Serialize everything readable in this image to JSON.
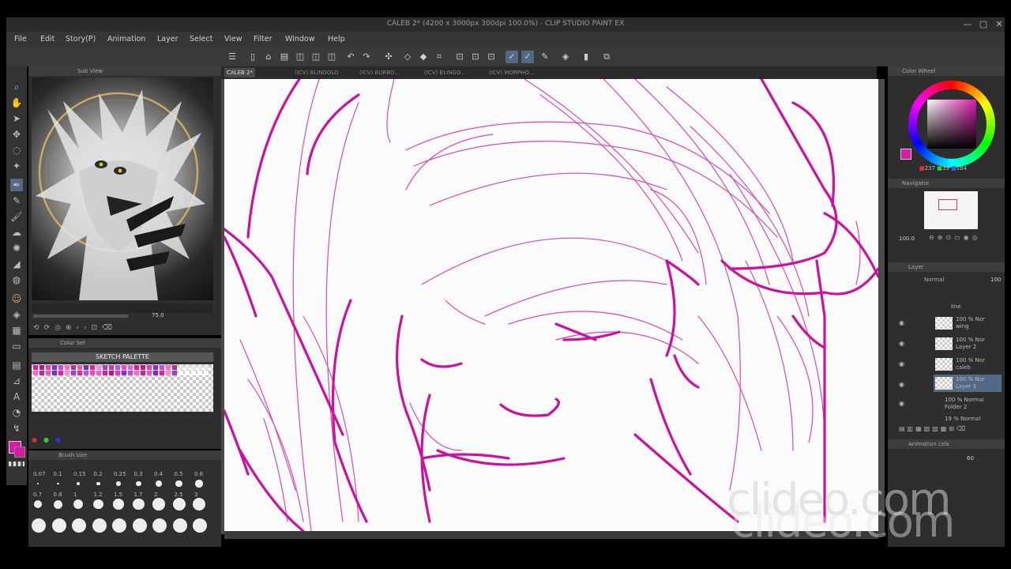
{
  "window": {
    "title": "CALEB 2* (4200 x 3000px 300dpi 100.0%) - CLIP STUDIO PAINT EX"
  },
  "menu": [
    "File",
    "Edit",
    "Story(P)",
    "Animation",
    "Layer",
    "Select",
    "View",
    "Filter",
    "Window",
    "Help"
  ],
  "canvas_tabs": [
    "CALEB 2*",
    "(ICV) BLINGOLO",
    "(ICV) BURBO...",
    "(ICV) BLINGO...",
    "(ICV) MORPHO..."
  ],
  "subview": {
    "title": "Sub View",
    "zoom": "75.0"
  },
  "color_set": {
    "title": "Color Set",
    "palette_name": "SKETCH PALETTE"
  },
  "brush_size": {
    "title": "Brush size",
    "sizes_row1": [
      "0.07",
      "0.1",
      "0.15",
      "0.2",
      "0.25",
      "0.3",
      "0.4",
      "0.5",
      "0.6"
    ],
    "sizes_row2": [
      "0.7",
      "0.8",
      "1",
      "1.2",
      "1.5",
      "1.7",
      "2",
      "2.5",
      "3"
    ]
  },
  "color_wheel": {
    "title": "Color Wheel",
    "r": "237",
    "g": "39",
    "b": "184"
  },
  "navigator": {
    "title": "Navigator",
    "zoom": "100.0"
  },
  "layer": {
    "title": "Layer",
    "blend_mode": "Normal",
    "opacity": "100",
    "folder_name": "line",
    "rows": [
      {
        "line1": "100 % Nor",
        "line2": "wing"
      },
      {
        "line1": "100 % Nor",
        "line2": "Layer 2"
      },
      {
        "line1": "100 % Nor",
        "line2": "caleb"
      },
      {
        "line1": "100 % Nor",
        "line2": "Layer 1"
      },
      {
        "line1": "100 % Normal",
        "line2": "Folder 2"
      },
      {
        "line1": "19 % Normal",
        "line2": ""
      }
    ]
  },
  "animation": {
    "title": "Animation cels",
    "value": "60"
  },
  "watermark": "clideo.com",
  "colors": {
    "accent": "#d91aa8",
    "stroke": "#cc10a0",
    "ui_dark": "#2e2e2e",
    "active_tool": "#536a86"
  }
}
